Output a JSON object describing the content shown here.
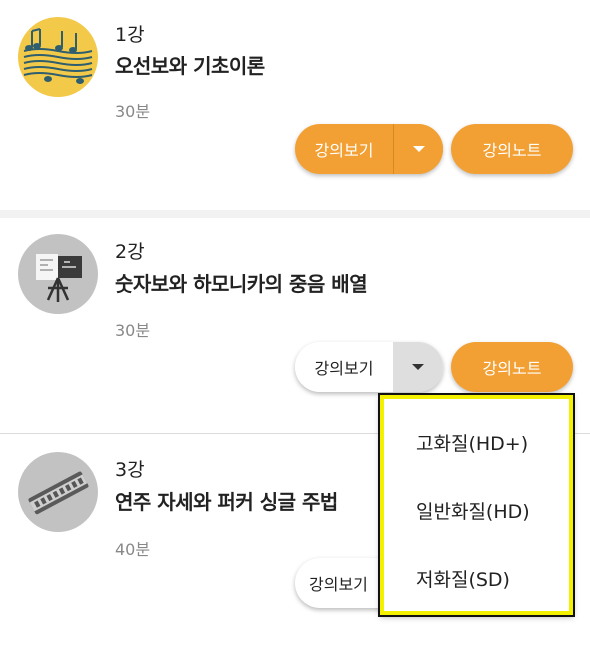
{
  "lessons": [
    {
      "number": "1강",
      "title": "오선보와 기초이론",
      "duration": "30분",
      "view_label": "강의보기",
      "note_label": "강의노트",
      "thumbnail_icon": "music-staff-icon"
    },
    {
      "number": "2강",
      "title": "숫자보와 하모니카의 중음 배열",
      "duration": "30분",
      "view_label": "강의보기",
      "note_label": "강의노트",
      "thumbnail_icon": "presentation-board-icon"
    },
    {
      "number": "3강",
      "title": "연주 자세와 퍼커 싱글 주법",
      "duration": "40분",
      "view_label": "강의보기",
      "thumbnail_icon": "harmonica-icon"
    }
  ],
  "quality_menu": {
    "options": [
      "고화질(HD+)",
      "일반화질(HD)",
      "저화질(SD)"
    ]
  },
  "colors": {
    "accent": "#f2a033",
    "highlight": "#f3f000"
  }
}
